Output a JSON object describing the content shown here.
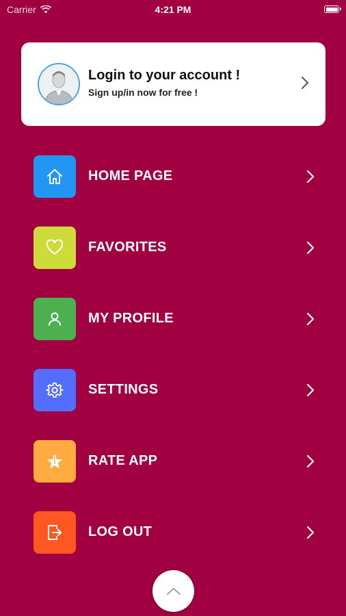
{
  "status_bar": {
    "carrier": "Carrier",
    "time": "4:21 PM"
  },
  "login_card": {
    "title": "Login to your account !",
    "subtitle": "Sign up/in now for free !"
  },
  "menu": [
    {
      "label": "HOME PAGE",
      "icon": "home-icon",
      "color": "#2196f3"
    },
    {
      "label": "FAVORITES",
      "icon": "heart-icon",
      "color": "#cddc39"
    },
    {
      "label": "MY PROFILE",
      "icon": "user-icon",
      "color": "#4caf50"
    },
    {
      "label": "SETTINGS",
      "icon": "gear-icon",
      "color": "#536dfe"
    },
    {
      "label": "RATE APP",
      "icon": "star-icon",
      "color": "#ffab40"
    },
    {
      "label": "LOG OUT",
      "icon": "logout-icon",
      "color": "#ff5722"
    }
  ],
  "colors": {
    "background": "#a10041",
    "card": "#ffffff",
    "avatar_border": "#4aa3e8"
  }
}
